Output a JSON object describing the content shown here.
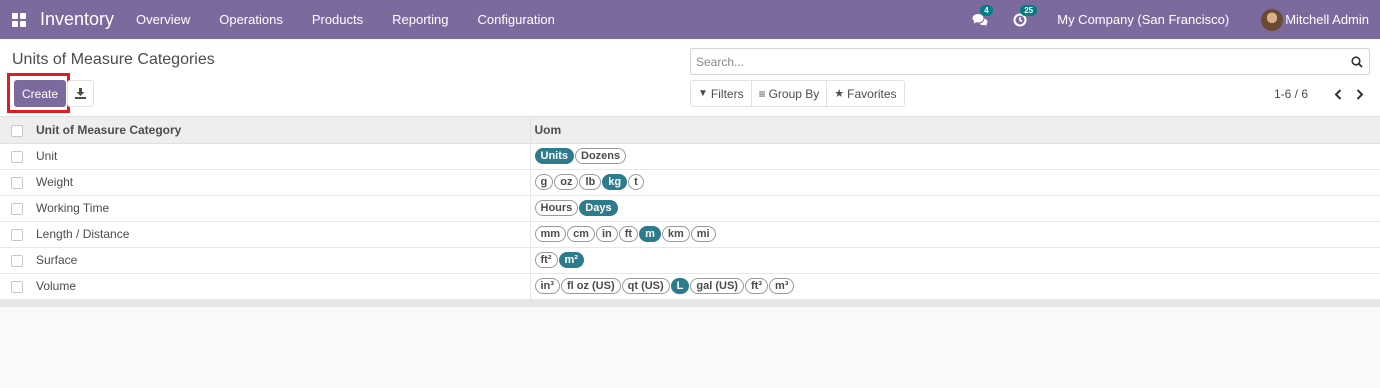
{
  "navbar": {
    "app_name": "Inventory",
    "menu": [
      "Overview",
      "Operations",
      "Products",
      "Reporting",
      "Configuration"
    ],
    "messages_count": "4",
    "activities_count": "25",
    "company": "My Company (San Francisco)",
    "user": "Mitchell Admin",
    "bg_color": "#7c6a9e"
  },
  "control": {
    "title": "Units of Measure Categories",
    "create_label": "Create",
    "search_placeholder": "Search...",
    "filters_label": "Filters",
    "group_by_label": "Group By",
    "favorites_label": "Favorites",
    "pager": "1-6 / 6"
  },
  "table": {
    "headers": {
      "category": "Unit of Measure Category",
      "uom": "Uom"
    },
    "rows": [
      {
        "category": "Unit",
        "uoms": [
          {
            "label": "Units",
            "ref": true
          },
          {
            "label": "Dozens",
            "ref": false
          }
        ]
      },
      {
        "category": "Weight",
        "uoms": [
          {
            "label": "g",
            "ref": false
          },
          {
            "label": "oz",
            "ref": false
          },
          {
            "label": "lb",
            "ref": false
          },
          {
            "label": "kg",
            "ref": true
          },
          {
            "label": "t",
            "ref": false
          }
        ]
      },
      {
        "category": "Working Time",
        "uoms": [
          {
            "label": "Hours",
            "ref": false
          },
          {
            "label": "Days",
            "ref": true
          }
        ]
      },
      {
        "category": "Length / Distance",
        "uoms": [
          {
            "label": "mm",
            "ref": false
          },
          {
            "label": "cm",
            "ref": false
          },
          {
            "label": "in",
            "ref": false
          },
          {
            "label": "ft",
            "ref": false
          },
          {
            "label": "m",
            "ref": true
          },
          {
            "label": "km",
            "ref": false
          },
          {
            "label": "mi",
            "ref": false
          }
        ]
      },
      {
        "category": "Surface",
        "uoms": [
          {
            "label": "ft²",
            "ref": false
          },
          {
            "label": "m²",
            "ref": true
          }
        ]
      },
      {
        "category": "Volume",
        "uoms": [
          {
            "label": "in³",
            "ref": false
          },
          {
            "label": "fl oz (US)",
            "ref": false
          },
          {
            "label": "qt (US)",
            "ref": false
          },
          {
            "label": "L",
            "ref": true
          },
          {
            "label": "gal (US)",
            "ref": false
          },
          {
            "label": "ft³",
            "ref": false
          },
          {
            "label": "m³",
            "ref": false
          }
        ]
      }
    ]
  },
  "colors": {
    "accent": "#7c6a9e",
    "reference_tag": "#2d7b8c",
    "highlight_border": "#e01b24"
  }
}
